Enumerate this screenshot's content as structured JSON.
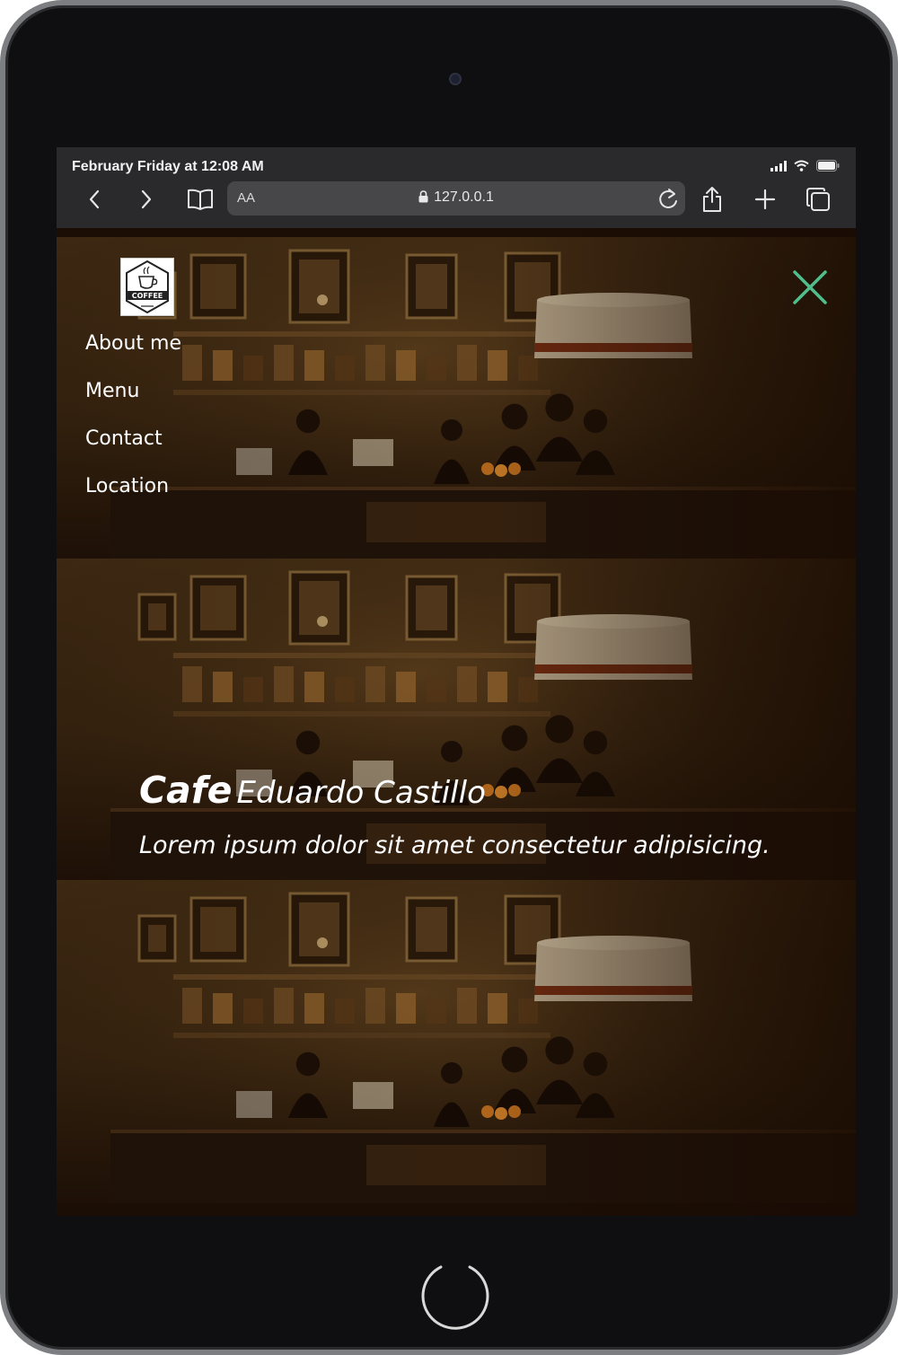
{
  "statusbar": {
    "time": "February Friday at 12:08 AM"
  },
  "browser": {
    "text_size_label": "AA",
    "url": "127.0.0.1"
  },
  "logo": {
    "text": "COFFEE"
  },
  "nav": {
    "items": [
      {
        "label": "About me"
      },
      {
        "label": "Menu"
      },
      {
        "label": "Contact"
      },
      {
        "label": "Location"
      }
    ]
  },
  "hero": {
    "title_strong": "Cafe",
    "title_rest": "Eduardo Castillo",
    "subtitle": "Lorem ipsum dolor sit amet consectetur adipisicing."
  },
  "colors": {
    "close_icon": "#4fc08d",
    "overlay": "#1b0e05"
  },
  "icons": [
    "back-icon",
    "forward-icon",
    "bookmarks-icon",
    "lock-icon",
    "reload-icon",
    "share-icon",
    "new-tab-icon",
    "tabs-icon",
    "signal-icon",
    "wifi-icon",
    "battery-icon",
    "close-icon"
  ]
}
